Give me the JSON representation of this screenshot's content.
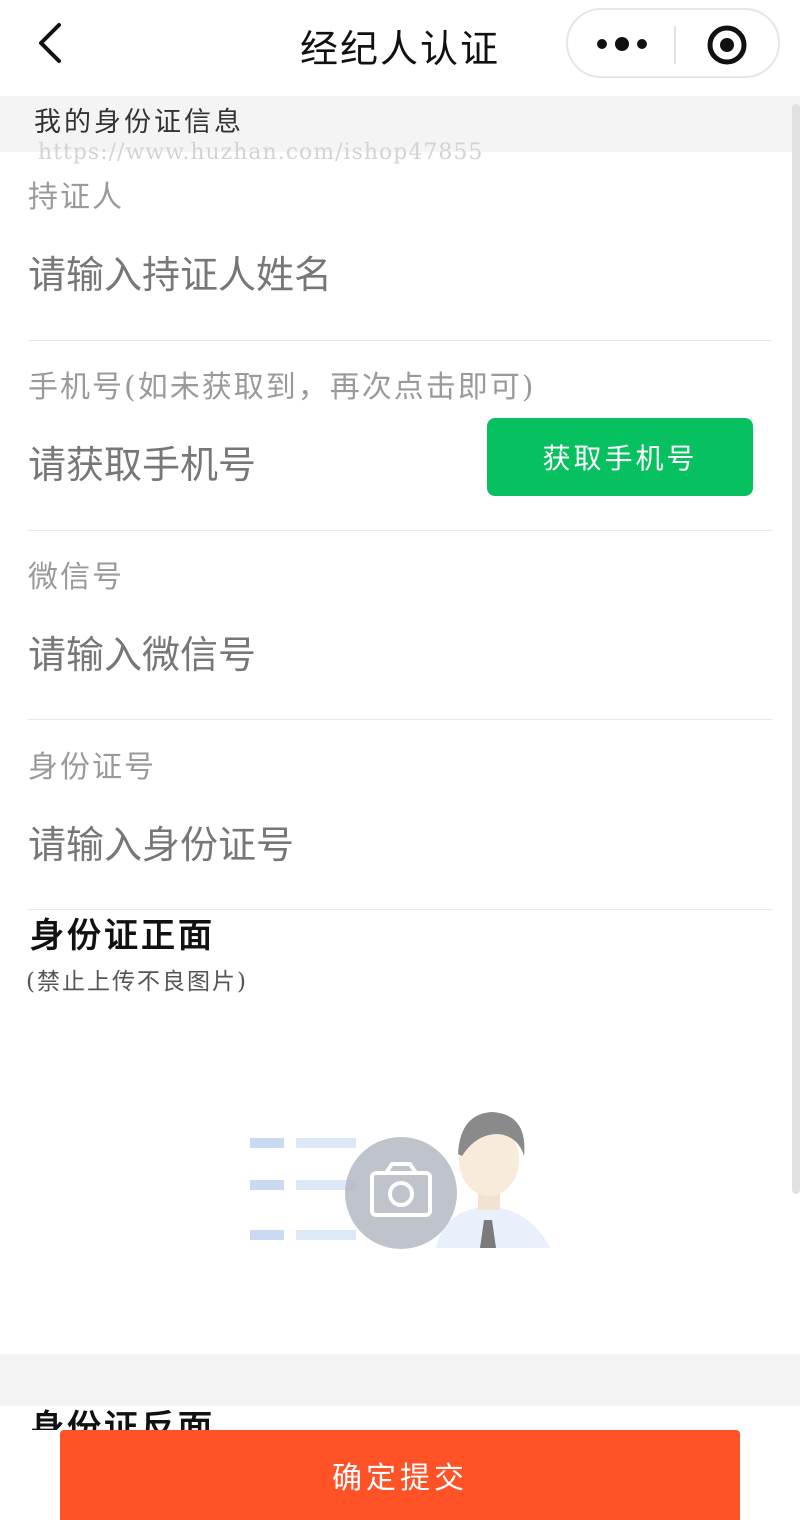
{
  "header": {
    "title": "经纪人认证"
  },
  "section": {
    "title": "我的身份证信息"
  },
  "watermark": "https://www.huzhan.com/ishop47855",
  "form": {
    "holder": {
      "label": "持证人",
      "placeholder": "请输入持证人姓名"
    },
    "phone": {
      "label": "手机号(如未获取到，再次点击即可)",
      "placeholder": "请获取手机号",
      "button": "获取手机号"
    },
    "wechat": {
      "label": "微信号",
      "placeholder": "请输入微信号"
    },
    "idnum": {
      "label": "身份证号",
      "placeholder": "请输入身份证号"
    }
  },
  "id_front": {
    "title": "身份证正面",
    "note": "(禁止上传不良图片)"
  },
  "id_back": {
    "title": "身份证反面"
  },
  "submit": {
    "label": "确定提交"
  },
  "colors": {
    "green": "#07c160",
    "orange": "#ff5227"
  }
}
